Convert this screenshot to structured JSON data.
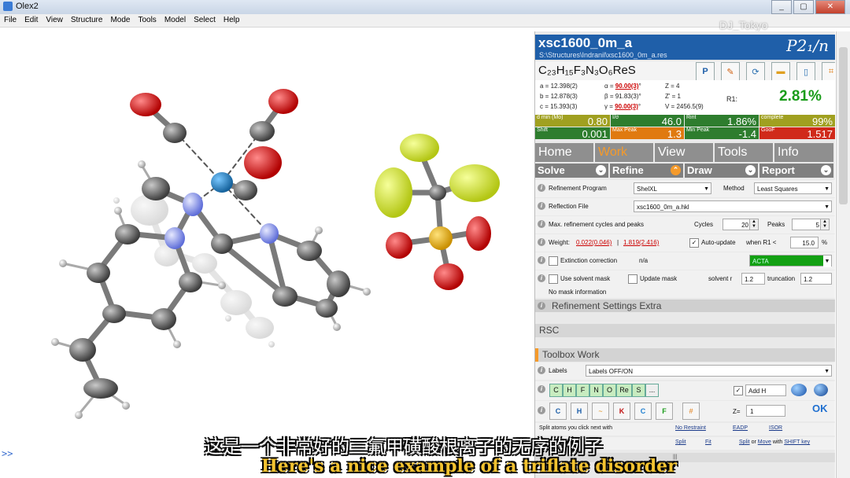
{
  "window": {
    "title": "Olex2",
    "btn_min": "_",
    "btn_max": "▢",
    "btn_close": "✕"
  },
  "menu": [
    "File",
    "Edit",
    "View",
    "Structure",
    "Mode",
    "Tools",
    "Model",
    "Select",
    "Help"
  ],
  "watermark": "DJ_Tokyo",
  "console": {
    "prompt": ">>"
  },
  "subtitles": {
    "chinese": "这是一个非常好的三氟甲磺酸根离子的无序的例子",
    "english": "Here's a nice example of a triflate disorder"
  },
  "structure": {
    "name": "xsc1600_0m_a",
    "path": "S:\\Structures\\Indranil\\xsc1600_0m_a.res",
    "space_group": "P2₁/n",
    "formula": "C₂₃H₁₅F₃N₃O₆ReS",
    "toolbar_icons": [
      "P",
      "pen-icon",
      "recycle-icon",
      "folder-icon",
      "phone-icon",
      "frame-icon"
    ]
  },
  "cell": {
    "a": "a = 12.398(2)",
    "b": "b = 12.878(3)",
    "c": "c = 15.393(3)",
    "alpha_label": "α = ",
    "alpha_val": "90.00(3)",
    "alpha_deg": "°",
    "beta": "β = 91.83(3)°",
    "gamma_label": "γ = ",
    "gamma_val": "90.00(3)",
    "gamma_deg": "°",
    "Z": "Z = 4",
    "Zp": "Z' = 1",
    "V": "V = 2456.5(9)",
    "r1_label": "R1:",
    "r1_value": "2.81%"
  },
  "stats": [
    {
      "label": "d min (Mo)",
      "value": "0.80",
      "color": "#a0a020"
    },
    {
      "label": "I/σ",
      "value": "46.0",
      "color": "#2e7d2e"
    },
    {
      "label": "Rint",
      "value": "1.86%",
      "color": "#2e7d2e"
    },
    {
      "label": "complete",
      "value": "99%",
      "color": "#a0a020"
    },
    {
      "label": "Shift",
      "value": "0.001",
      "color": "#2e7d2e"
    },
    {
      "label": "Max Peak",
      "value": "1.3",
      "color": "#e07a10"
    },
    {
      "label": "Min Peak",
      "value": "-1.4",
      "color": "#2e7d2e"
    },
    {
      "label": "GooF",
      "value": "1.517",
      "color": "#d02a1a"
    }
  ],
  "tabs": [
    "Home",
    "Work",
    "View",
    "Tools",
    "Info"
  ],
  "subtabs": [
    "Solve",
    "Refine",
    "Draw",
    "Report"
  ],
  "refine": {
    "program_label": "Refinement Program",
    "program_value": "ShelXL",
    "method_label": "Method",
    "method_value": "Least Squares",
    "reflection_label": "Reflection File",
    "reflection_value": "xsc1600_0m_a.hkl",
    "cycles_text": "Max. refinement cycles and peaks",
    "cycles_label": "Cycles",
    "cycles_value": "20",
    "peaks_label": "Peaks",
    "peaks_value": "5",
    "weight_label": "Weight:",
    "weight_a": "0.022(0.046)",
    "weight_sep": " | ",
    "weight_b": "1.819(2.416)",
    "autoupdate_label": "Auto-update",
    "when_label": "when R1 <",
    "when_value": "15.0",
    "pct": "%",
    "extinction_label": "Extinction correction",
    "extinction_value": "n/a",
    "acta_value": "ACTA",
    "solvent_label": "Use solvent mask",
    "update_mask_label": "Update mask",
    "solvent_r_label": "solvent r",
    "solvent_r_value": "1.2",
    "truncation_label": "truncation",
    "truncation_value": "1.2",
    "no_mask": "No mask information",
    "extra_section": "Refinement Settings Extra"
  },
  "rsc": "RSC",
  "toolbox": {
    "title": "Toolbox Work",
    "labels_label": "Labels",
    "labels_value": "Labels OFF/ON",
    "atoms": [
      "C",
      "H",
      "F",
      "N",
      "O",
      "Re",
      "S",
      "..."
    ],
    "addh": "Add H",
    "z_label": "Z=",
    "z_value": "1",
    "ok": "OK",
    "tool_icons": [
      "C",
      "H",
      "~",
      "K",
      "C",
      "F",
      "#"
    ],
    "split_text": "Split atoms you click next with",
    "no_restraint": "No Restraint",
    "eadp": "EADP",
    "isor": "ISOR",
    "split": "Split",
    "fit": "Fit",
    "split_or_move": "Split",
    "or_text": " or ",
    "move": "Move",
    "with_text": " with ",
    "shift_key": "SHIFT key"
  },
  "colors": {
    "panel_header": "#1f5fa9",
    "active_tab": "#f59a2a",
    "r1": "#1a9c1a",
    "acta_bar": "#12a012"
  }
}
